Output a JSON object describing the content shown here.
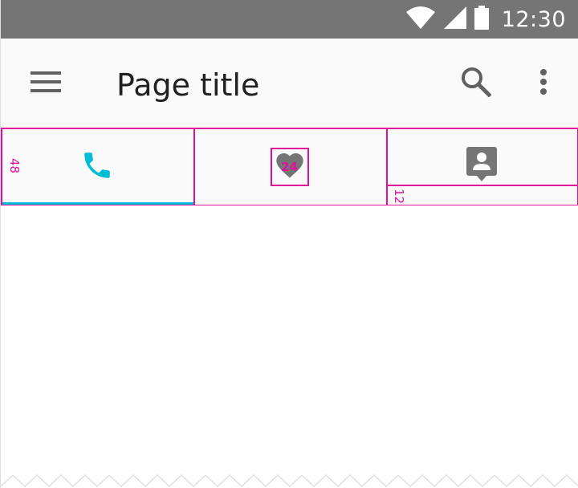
{
  "status_bar": {
    "time": "12:30",
    "icons": [
      "wifi-icon",
      "cellular-signal-icon",
      "battery-icon"
    ]
  },
  "app_bar": {
    "title": "Page title",
    "icons": [
      "menu-icon",
      "search-icon",
      "more-vert-icon"
    ]
  },
  "tabs": [
    {
      "icon": "phone-icon",
      "selected": true
    },
    {
      "icon": "heart-icon",
      "selected": false
    },
    {
      "icon": "contact-icon",
      "selected": false
    }
  ],
  "annotations": {
    "tab_height": "48",
    "icon_size": "24",
    "bottom_padding": "12"
  },
  "colors": {
    "status_bar": "#757575",
    "app_bar": "#fafafa",
    "accent": "#00bcd4",
    "icon": "#757575",
    "title": "#212121",
    "annotation": "#e0119d"
  }
}
